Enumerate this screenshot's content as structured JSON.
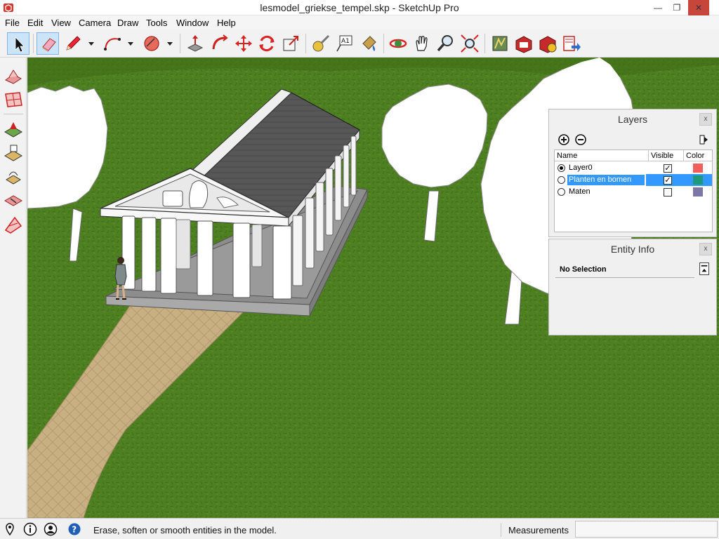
{
  "window": {
    "title": "lesmodel_griekse_tempel.skp - SketchUp Pro",
    "minimize": "—",
    "maximize": "❐",
    "close": "✕"
  },
  "menu": [
    "File",
    "Edit",
    "View",
    "Camera",
    "Draw",
    "Tools",
    "Window",
    "Help"
  ],
  "toolbar_icons": [
    "select-arrow-icon",
    "eraser-icon",
    "pencil-icon",
    "arc-icon",
    "rotated-shape-icon",
    "push-pull-icon",
    "follow-me-icon",
    "move-icon",
    "rotate-icon",
    "scale-icon",
    "tape-measure-icon",
    "text-icon",
    "paint-bucket-icon",
    "orbit-icon",
    "pan-icon",
    "zoom-icon",
    "zoom-extents-icon",
    "3d-warehouse-icon",
    "extension-warehouse-icon",
    "layout-icon",
    "send-to-layout-icon"
  ],
  "left_toolbar_icons": [
    "sandbox-smoove-icon",
    "sandbox-grid-icon",
    "sandbox-stamp-icon",
    "sandbox-drape-icon",
    "sandbox-add-detail-icon",
    "sandbox-flip-edge-icon",
    "sandbox-from-contours-icon"
  ],
  "layers": {
    "title": "Layers",
    "close": "x",
    "columns": {
      "name": "Name",
      "visible": "Visible",
      "color": "Color"
    },
    "rows": [
      {
        "name": "Layer0",
        "active": true,
        "visible": true,
        "color": "#f25d5d",
        "selected": false
      },
      {
        "name": "Planten en bomen",
        "active": false,
        "visible": true,
        "color": "#1e9a7a",
        "selected": true
      },
      {
        "name": "Maten",
        "active": false,
        "visible": false,
        "color": "#7b78a8",
        "selected": false
      }
    ]
  },
  "entity_info": {
    "title": "Entity Info",
    "close": "x",
    "status": "No Selection"
  },
  "statusbar": {
    "icons": [
      "geo-location-icon",
      "credits-icon",
      "user-account-icon",
      "help-icon"
    ],
    "message": "Erase, soften or smooth entities in the model.",
    "measurements_label": "Measurements",
    "measurements_value": ""
  },
  "colors": {
    "grass": "#4e8022",
    "path": "#c9b083",
    "roof": "#575757",
    "selection": "#3399ff"
  }
}
